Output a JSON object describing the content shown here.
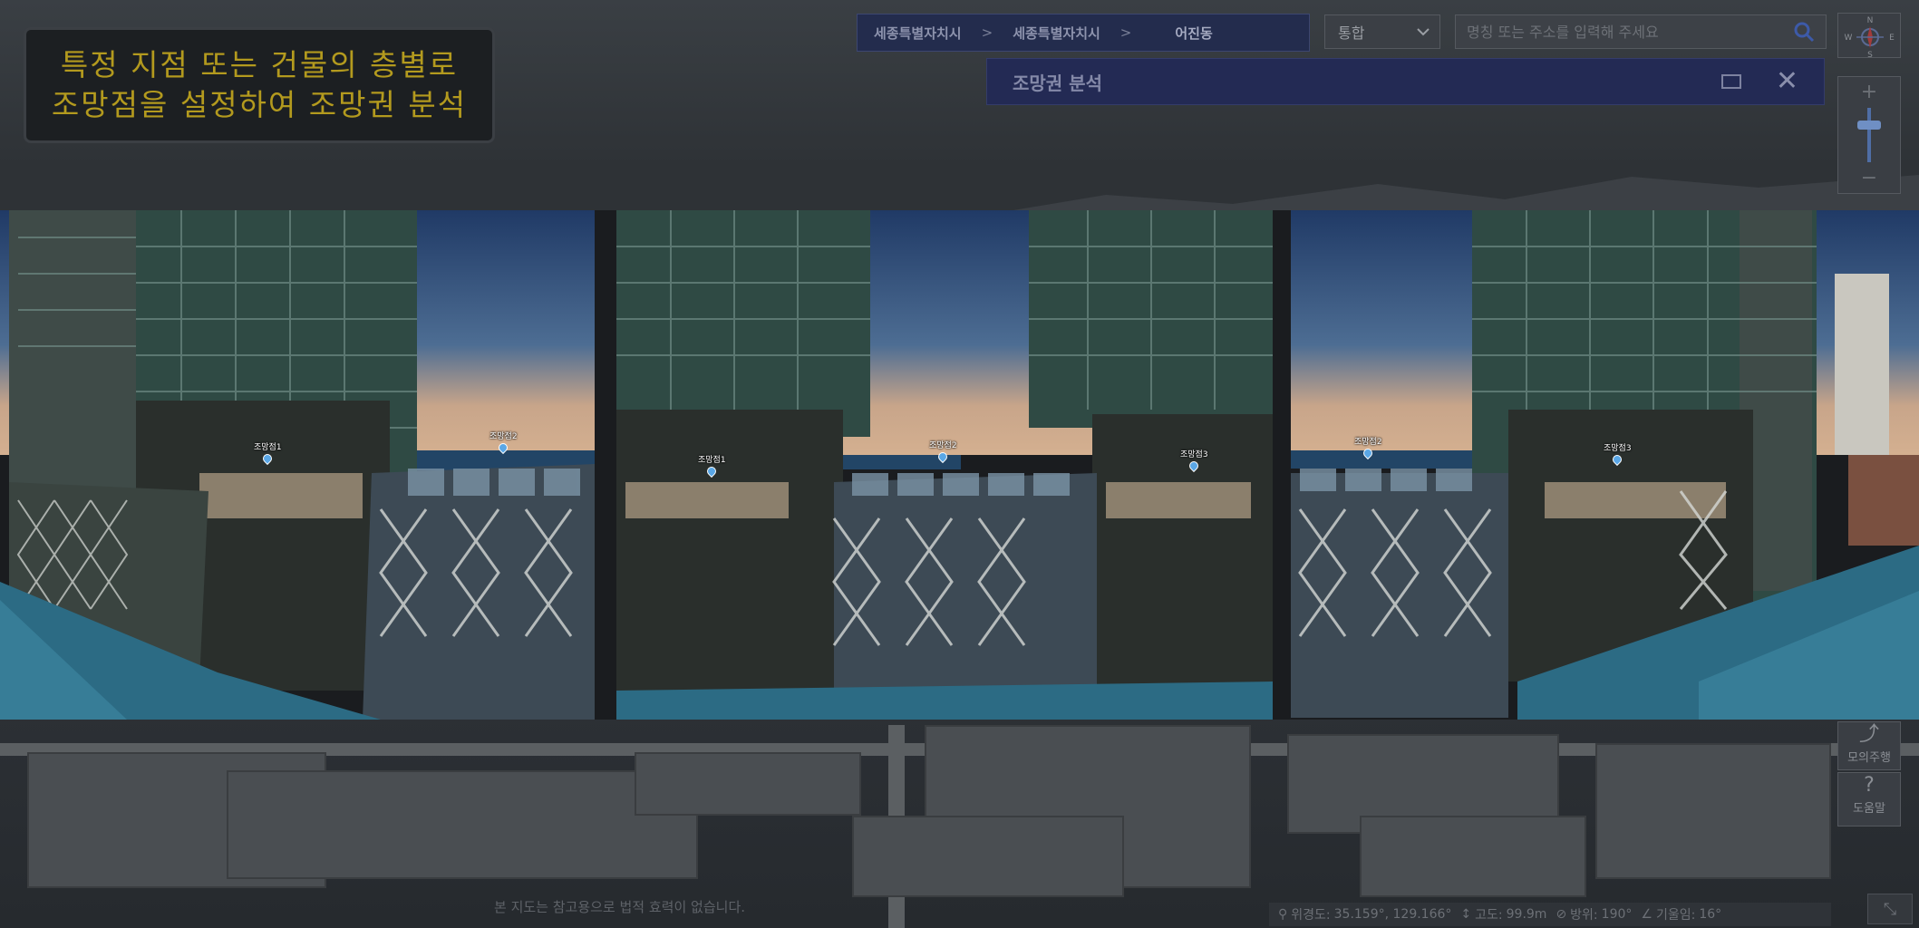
{
  "caption": {
    "line1": "특정 지점 또는 건물의 층별로",
    "line2": "조망점을 설정하여 조망권 분석"
  },
  "breadcrumb": {
    "level1": "세종특별자치시",
    "level2": "세종특별자치시",
    "level3": "어진동",
    "separator": ">"
  },
  "search": {
    "scope_selected": "통합",
    "placeholder": "명칭 또는 주소를 입력해 주세요"
  },
  "compass": {
    "n": "N",
    "w": "W",
    "e": "E",
    "s": "S"
  },
  "zoom": {
    "plus": "+",
    "minus": "−"
  },
  "panel": {
    "title": "조망권 분석"
  },
  "views": [
    {
      "markers": [
        "조망점1",
        "조망점2"
      ]
    },
    {
      "markers": [
        "조망점1",
        "조망점2",
        "조망점3"
      ]
    },
    {
      "markers": [
        "조망점2",
        "조망점3"
      ]
    }
  ],
  "side_tools": {
    "drive": "모의주행",
    "help": "도움말"
  },
  "notice": "본 지도는 참고용으로 법적 효력이 없습니다.",
  "status": {
    "coord_label": "위경도:",
    "coord_value": "35.159°, 129.166°",
    "alt_label": "고도:",
    "alt_value": "99.9m",
    "heading_label": "방위:",
    "heading_value": "190°",
    "tilt_label": "기울임:",
    "tilt_value": "16°"
  },
  "colors": {
    "caption_text": "#b39a1e",
    "panel_bg": "#232a54",
    "marker_pin": "#5aa7e6"
  }
}
